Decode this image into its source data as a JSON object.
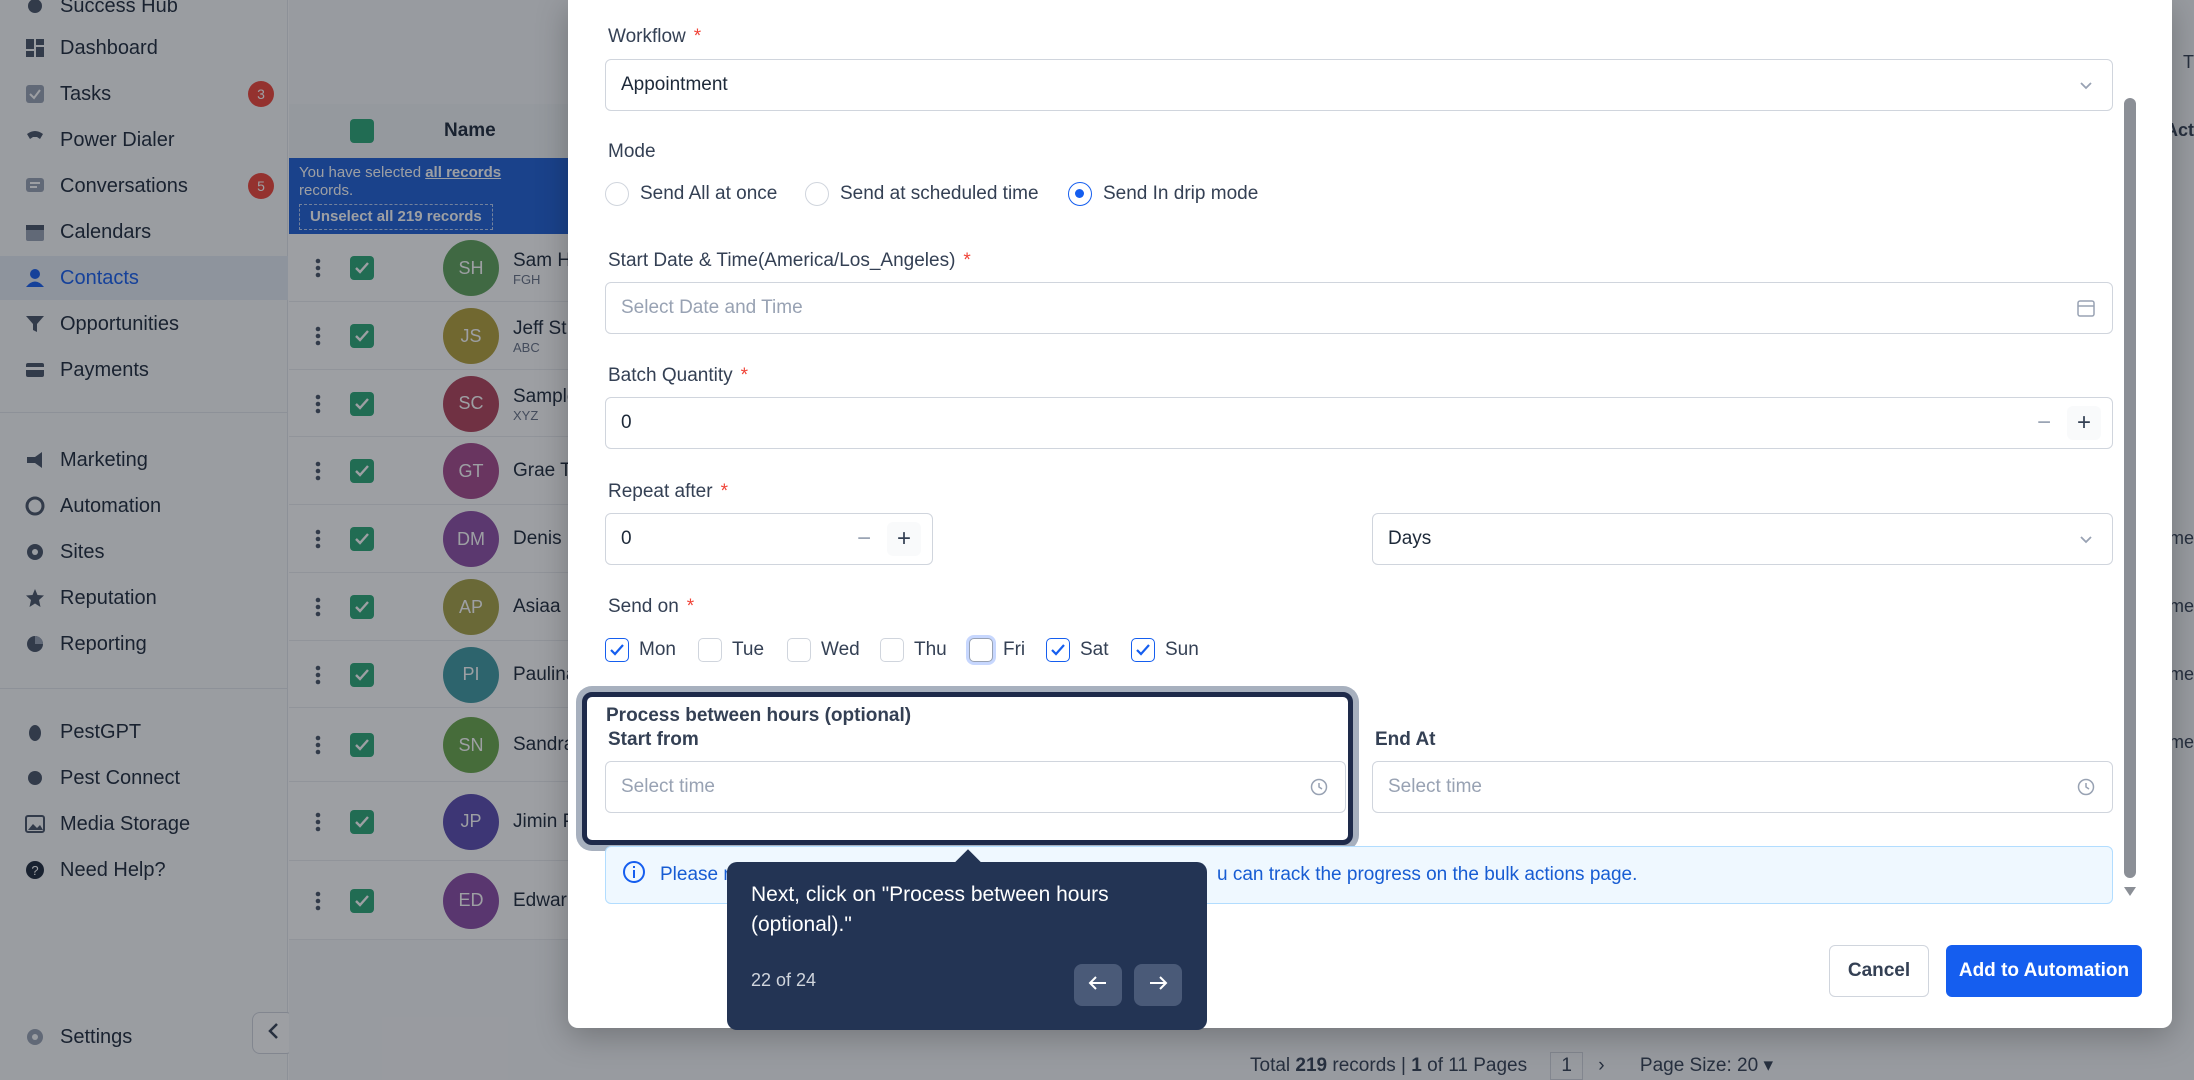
{
  "sidebar": {
    "items": [
      {
        "label": "Success Hub",
        "icon": "rocket-icon"
      },
      {
        "label": "Dashboard",
        "icon": "dashboard-icon"
      },
      {
        "label": "Tasks",
        "icon": "check-square-icon",
        "badge": "3"
      },
      {
        "label": "Power Dialer",
        "icon": "phone-icon"
      },
      {
        "label": "Conversations",
        "icon": "chat-icon",
        "badge": "5"
      },
      {
        "label": "Calendars",
        "icon": "calendar-icon"
      },
      {
        "label": "Contacts",
        "icon": "person-icon",
        "active": true
      },
      {
        "label": "Opportunities",
        "icon": "funnel-icon"
      },
      {
        "label": "Payments",
        "icon": "card-icon"
      },
      {
        "label": "Marketing",
        "icon": "megaphone-icon"
      },
      {
        "label": "Automation",
        "icon": "automation-icon"
      },
      {
        "label": "Sites",
        "icon": "globe-icon"
      },
      {
        "label": "Reputation",
        "icon": "star-icon"
      },
      {
        "label": "Reporting",
        "icon": "pie-chart-icon"
      },
      {
        "label": "PestGPT",
        "icon": "bug-icon"
      },
      {
        "label": "Pest Connect",
        "icon": "plug-icon"
      },
      {
        "label": "Media Storage",
        "icon": "image-icon"
      },
      {
        "label": "Need Help?",
        "icon": "help-icon"
      }
    ],
    "settings_label": "Settings"
  },
  "contacts_table": {
    "name_header": "Name",
    "banner_text_1": "You have selected",
    "banner_link": "all records",
    "banner_text_2": "records.",
    "unselect_label": "Unselect all 219 records",
    "rows": [
      {
        "initials": "SH",
        "name": "Sam H",
        "sub": "FGH",
        "color": "#5fa35a"
      },
      {
        "initials": "JS",
        "name": "Jeff St",
        "sub": "ABC",
        "color": "#b3a03a"
      },
      {
        "initials": "SC",
        "name": "Sample",
        "sub": "XYZ",
        "color": "#b2435a"
      },
      {
        "initials": "GT",
        "name": "Grae T",
        "sub": "",
        "color": "#a5498c"
      },
      {
        "initials": "DM",
        "name": "Denis",
        "sub": "",
        "color": "#8e4fa6"
      },
      {
        "initials": "AP",
        "name": "Asiaa",
        "sub": "",
        "color": "#a7a345"
      },
      {
        "initials": "PI",
        "name": "Paulina",
        "sub": "",
        "color": "#3f9aa3"
      },
      {
        "initials": "SN",
        "name": "Sandra",
        "sub": "",
        "color": "#6aa84a"
      },
      {
        "initials": "JP",
        "name": "Jimin P",
        "sub": "",
        "color": "#5a4bb0"
      },
      {
        "initials": "ED",
        "name": "Edwar",
        "sub": "",
        "color": "#8a4aa5"
      }
    ],
    "footer": {
      "total_prefix": "Total",
      "total": "219",
      "records_pages": "records |",
      "page": "1",
      "of_pages": "of 11 Pages",
      "page_box": "1",
      "page_size": "Page Size: 20"
    }
  },
  "modal": {
    "workflow_label": "Workflow",
    "workflow_value": "Appointment",
    "mode_label": "Mode",
    "mode_options": [
      "Send All at once",
      "Send at scheduled time",
      "Send In drip mode"
    ],
    "mode_selected": "Send In drip mode",
    "start_label": "Start Date & Time(America/Los_Angeles)",
    "start_placeholder": "Select Date and Time",
    "batch_label": "Batch Quantity",
    "batch_value": "0",
    "repeat_label": "Repeat after",
    "repeat_value": "0",
    "repeat_unit": "Days",
    "send_on_label": "Send on",
    "days": [
      {
        "label": "Mon",
        "checked": true
      },
      {
        "label": "Tue",
        "checked": false
      },
      {
        "label": "Wed",
        "checked": false
      },
      {
        "label": "Thu",
        "checked": false
      },
      {
        "label": "Fri",
        "checked": false
      },
      {
        "label": "Sat",
        "checked": true
      },
      {
        "label": "Sun",
        "checked": true
      }
    ],
    "process_label": "Process between hours (optional)",
    "start_from_label": "Start from",
    "start_from_placeholder": "Select time",
    "end_at_label": "End At",
    "end_at_placeholder": "Select time",
    "info_left": "Please n",
    "info_right": "u can track the progress on the bulk actions page.",
    "cancel_label": "Cancel",
    "add_label": "Add to Automation"
  },
  "tour": {
    "message": "Next, click on \"Process between hours (optional).\"",
    "counter": "22 of 24"
  },
  "edge_text": {
    "top_right": "T",
    "col_head": "Act",
    "row": "me"
  },
  "colors": {
    "primary": "#155eef",
    "tooltip": "#233454",
    "danger": "#f04438"
  }
}
